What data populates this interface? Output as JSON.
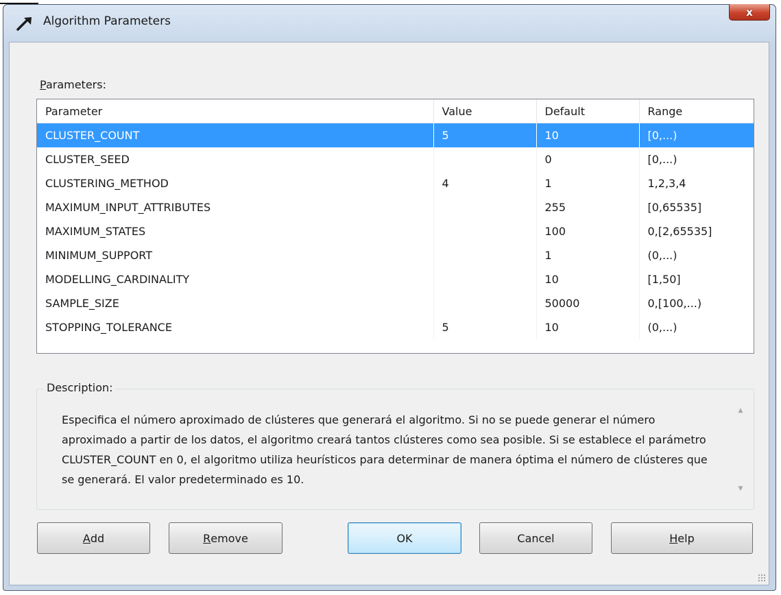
{
  "window": {
    "title": "Algorithm Parameters",
    "close_label": "x"
  },
  "parameters": {
    "label_accel": "P",
    "label_rest": "arameters:",
    "columns": [
      "Parameter",
      "Value",
      "Default",
      "Range"
    ],
    "rows": [
      {
        "parameter": "CLUSTER_COUNT",
        "value": "5",
        "default": "10",
        "range": "[0,...)",
        "selected": true
      },
      {
        "parameter": "CLUSTER_SEED",
        "value": "",
        "default": "0",
        "range": "[0,...)"
      },
      {
        "parameter": "CLUSTERING_METHOD",
        "value": "4",
        "default": "1",
        "range": "1,2,3,4"
      },
      {
        "parameter": "MAXIMUM_INPUT_ATTRIBUTES",
        "value": "",
        "default": "255",
        "range": "[0,65535]"
      },
      {
        "parameter": "MAXIMUM_STATES",
        "value": "",
        "default": "100",
        "range": "0,[2,65535]"
      },
      {
        "parameter": "MINIMUM_SUPPORT",
        "value": "",
        "default": "1",
        "range": "(0,...)"
      },
      {
        "parameter": "MODELLING_CARDINALITY",
        "value": "",
        "default": "10",
        "range": "[1,50]"
      },
      {
        "parameter": "SAMPLE_SIZE",
        "value": "",
        "default": "50000",
        "range": "0,[100,...)"
      },
      {
        "parameter": "STOPPING_TOLERANCE",
        "value": "5",
        "default": "10",
        "range": "(0,...)"
      }
    ]
  },
  "description": {
    "label": "Description:",
    "text": "Especifica el número aproximado de clústeres que generará el algoritmo. Si no se puede generar el número aproximado a partir de los datos, el algoritmo creará tantos clústeres como sea posible. Si se establece el parámetro CLUSTER_COUNT en 0, el algoritmo utiliza heurísticos para determinar de manera óptima el número de clústeres que se generará. El valor predeterminado es 10."
  },
  "buttons": {
    "add": {
      "accel": "A",
      "rest": "dd"
    },
    "remove": {
      "accel": "R",
      "rest": "emove"
    },
    "ok": "OK",
    "cancel": "Cancel",
    "help": {
      "accel": "H",
      "rest": "elp"
    }
  },
  "colors": {
    "selection": "#3399ff",
    "close_button": "#c9432c",
    "default_button_border": "#3c7fb1"
  }
}
